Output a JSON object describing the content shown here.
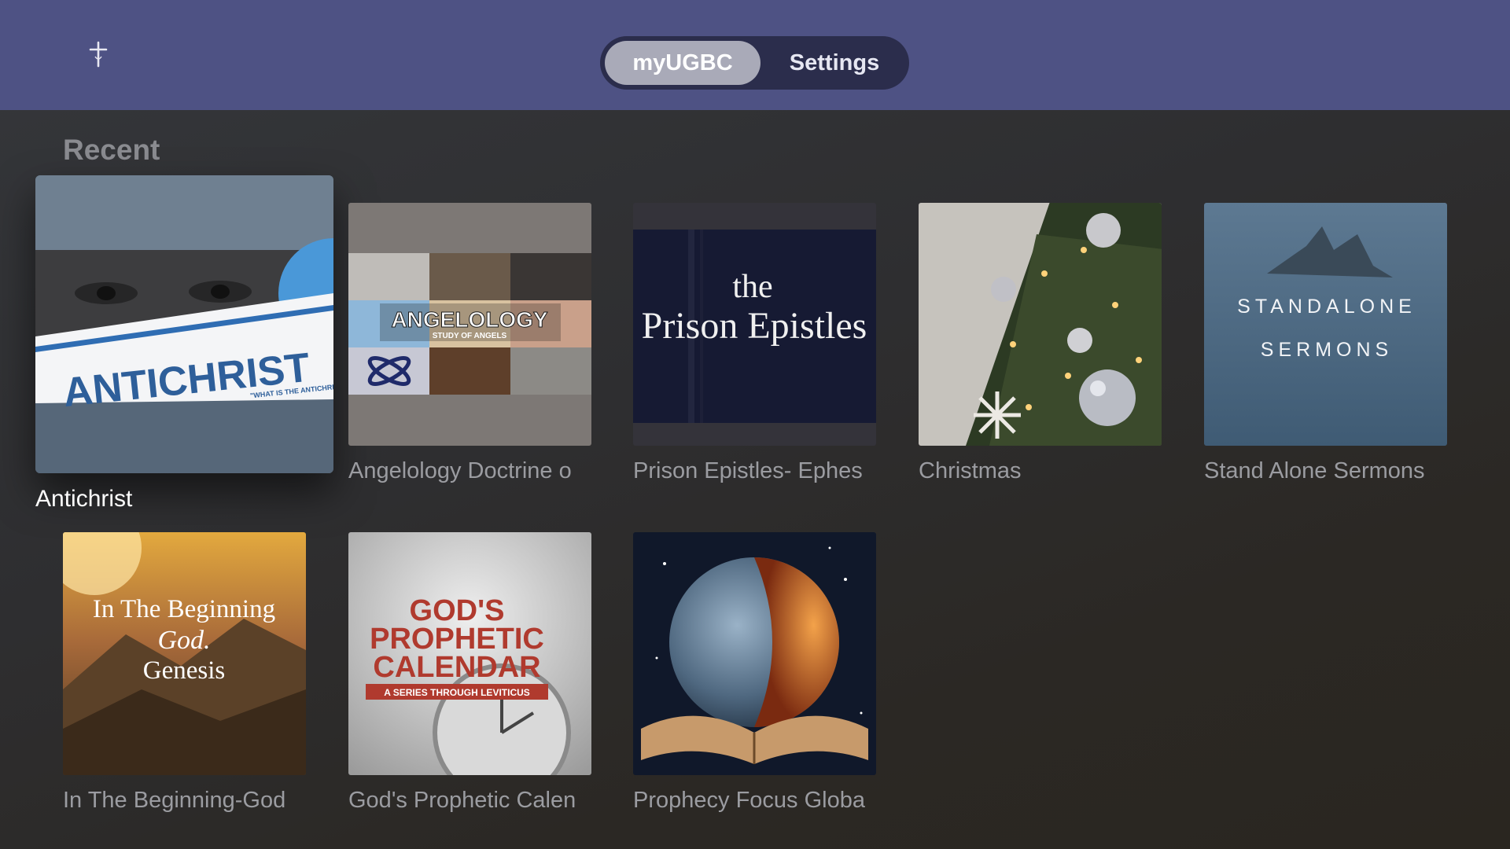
{
  "header": {
    "logo_icon": "cross-icon",
    "tabs": [
      {
        "label": "myUGBC",
        "active": true
      },
      {
        "label": "Settings",
        "active": false
      }
    ]
  },
  "section": {
    "title": "Recent"
  },
  "tiles": [
    {
      "label": "Antichrist",
      "art_title": "ANTICHRIST",
      "art_subtitle": "\"WHAT IS THE ANTICHRIST?\"",
      "focused": true
    },
    {
      "label": "Angelology Doctrine o",
      "art_title": "ANGELOLOGY",
      "art_subtitle": "STUDY OF ANGELS"
    },
    {
      "label": "Prison Epistles- Ephes",
      "art_line1": "the",
      "art_line2": "Prison Epistles"
    },
    {
      "label": "Christmas"
    },
    {
      "label": "Stand Alone Sermons",
      "art_line1": "STANDALONE",
      "art_line2": "SERMONS"
    },
    {
      "label": "In The Beginning-God",
      "art_line1": "In The Beginning",
      "art_line2": "God.",
      "art_line3": "Genesis"
    },
    {
      "label": "God's Prophetic Calen",
      "art_line1": "GOD'S",
      "art_line2": "PROPHETIC",
      "art_line3": "CALENDAR",
      "art_subtitle": "A SERIES THROUGH LEVITICUS"
    },
    {
      "label": "Prophecy Focus Globa"
    }
  ],
  "colors": {
    "header_bg": "#4e5284",
    "tabbar_bg": "#2b2d4c",
    "active_tab_bg": "#a9aab8",
    "label_text": "#9b9ca1",
    "focused_label_text": "#ffffff"
  }
}
